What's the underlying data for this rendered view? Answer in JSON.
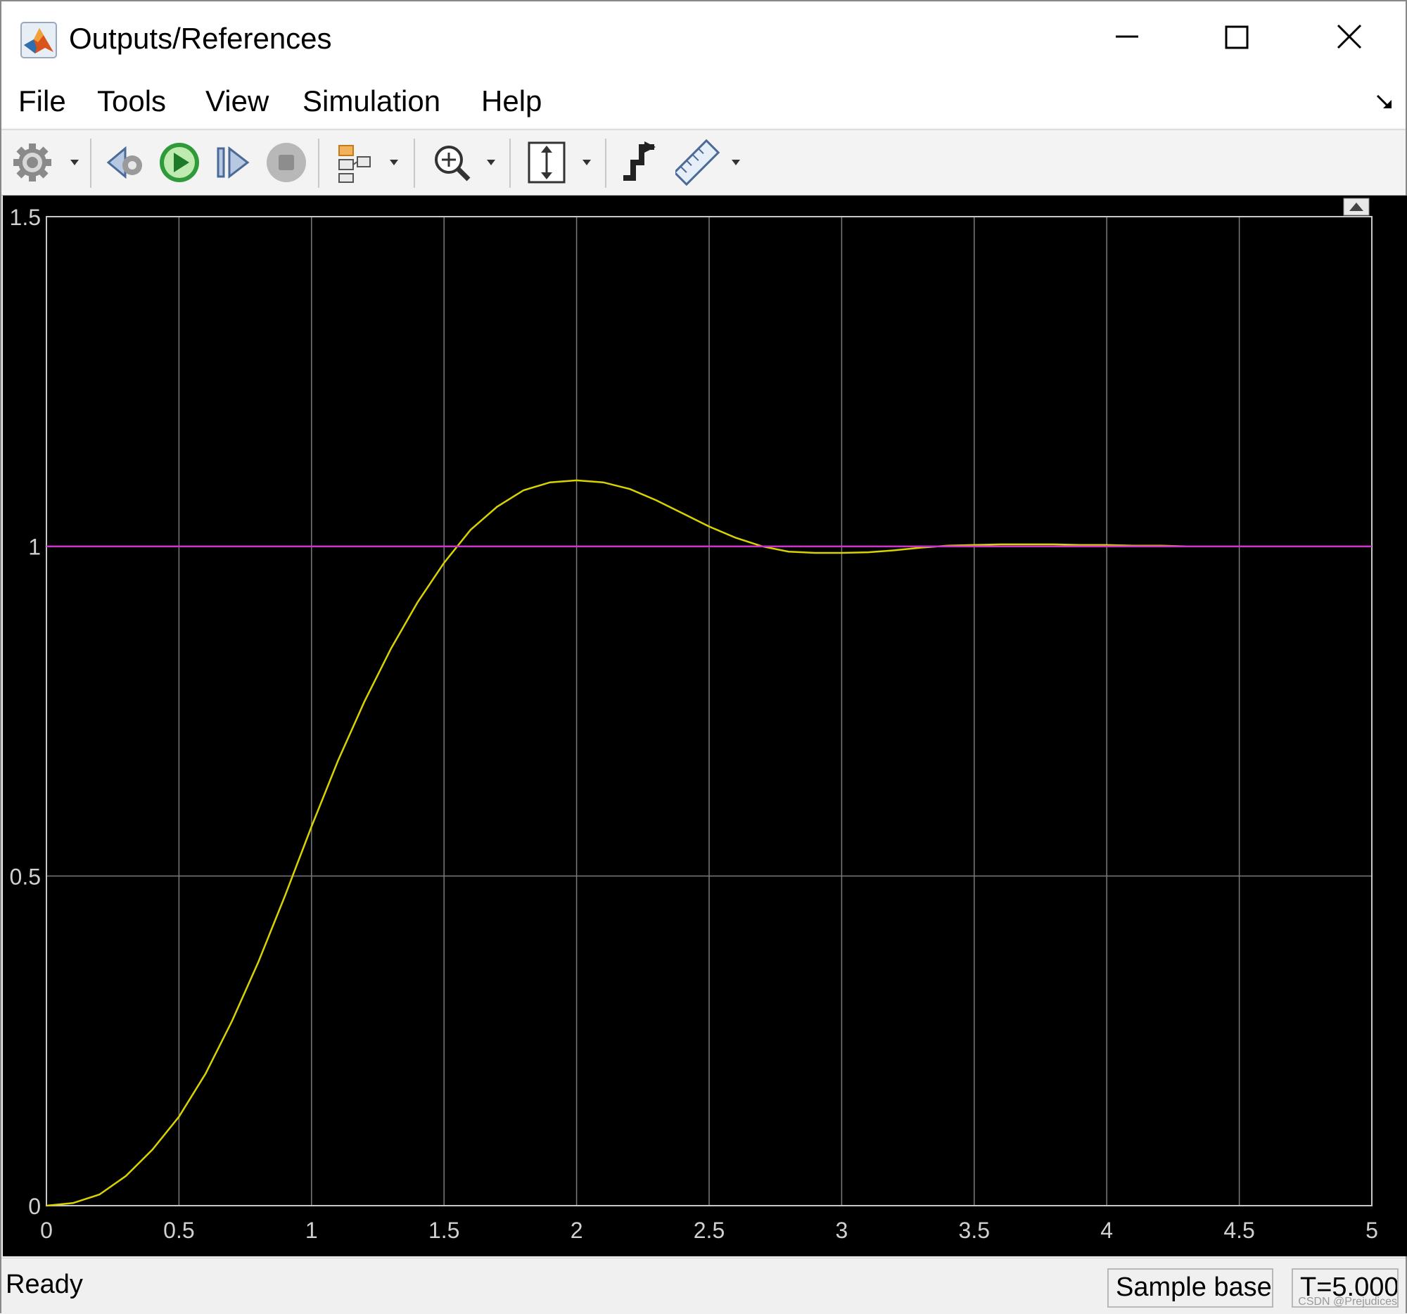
{
  "window": {
    "title": "Outputs/References"
  },
  "menu": {
    "items": [
      "File",
      "Tools",
      "View",
      "Simulation",
      "Help"
    ]
  },
  "toolbar": {
    "buttons": [
      {
        "name": "settings-button",
        "icon": "gear-icon"
      },
      {
        "name": "step-back-button",
        "icon": "step-back-icon"
      },
      {
        "name": "run-button",
        "icon": "play-icon"
      },
      {
        "name": "step-forward-button",
        "icon": "step-forward-icon"
      },
      {
        "name": "stop-button",
        "icon": "stop-icon"
      },
      {
        "name": "highlight-block-button",
        "icon": "highlight-block-icon"
      },
      {
        "name": "zoom-button",
        "icon": "zoom-in-icon"
      },
      {
        "name": "scale-axes-button",
        "icon": "scale-y-axis-icon"
      },
      {
        "name": "triggers-button",
        "icon": "trigger-icon"
      },
      {
        "name": "measurements-button",
        "icon": "ruler-icon"
      }
    ]
  },
  "status": {
    "left": "Ready",
    "mode": "Sample based",
    "time": "T=5.000"
  },
  "watermark": "CSDN @Prejudices",
  "colors": {
    "plot_background": "#000000",
    "grid": "#7a7a7a",
    "axes": "#c8c8c8",
    "output_line": "#d8d200",
    "reference_line": "#cc33cc"
  },
  "chart_data": {
    "type": "line",
    "title": "",
    "xlabel": "",
    "ylabel": "",
    "xlim": [
      0,
      5
    ],
    "ylim": [
      0,
      1.5
    ],
    "grid": true,
    "xticks": [
      "0",
      "0.5",
      "1",
      "1.5",
      "2",
      "2.5",
      "3",
      "3.5",
      "4",
      "4.5",
      "5"
    ],
    "yticks": [
      "0",
      "0.5",
      "1",
      "1.5"
    ],
    "series": [
      {
        "color": "#d8d200",
        "x": [
          0,
          0.1,
          0.2,
          0.3,
          0.4,
          0.5,
          0.6,
          0.7,
          0.8,
          0.9,
          1.0,
          1.1,
          1.2,
          1.3,
          1.4,
          1.5,
          1.6,
          1.7,
          1.8,
          1.9,
          2.0,
          2.1,
          2.2,
          2.3,
          2.4,
          2.5,
          2.6,
          2.7,
          2.8,
          2.9,
          3.0,
          3.1,
          3.2,
          3.3,
          3.4,
          3.5,
          3.6,
          3.7,
          3.8,
          3.9,
          4.0,
          4.1,
          4.2,
          4.3,
          4.4
        ],
        "y": [
          0,
          0.004,
          0.017,
          0.045,
          0.085,
          0.135,
          0.2,
          0.28,
          0.37,
          0.47,
          0.575,
          0.675,
          0.765,
          0.845,
          0.915,
          0.975,
          1.025,
          1.06,
          1.085,
          1.097,
          1.1,
          1.097,
          1.087,
          1.07,
          1.05,
          1.03,
          1.013,
          1.0,
          0.992,
          0.99,
          0.99,
          0.991,
          0.994,
          0.998,
          1.001,
          1.002,
          1.003,
          1.003,
          1.003,
          1.002,
          1.002,
          1.001,
          1.001,
          1.0,
          1.0
        ]
      },
      {
        "color": "#cc33cc",
        "x": [
          0,
          5
        ],
        "y": [
          1,
          1
        ]
      }
    ]
  }
}
